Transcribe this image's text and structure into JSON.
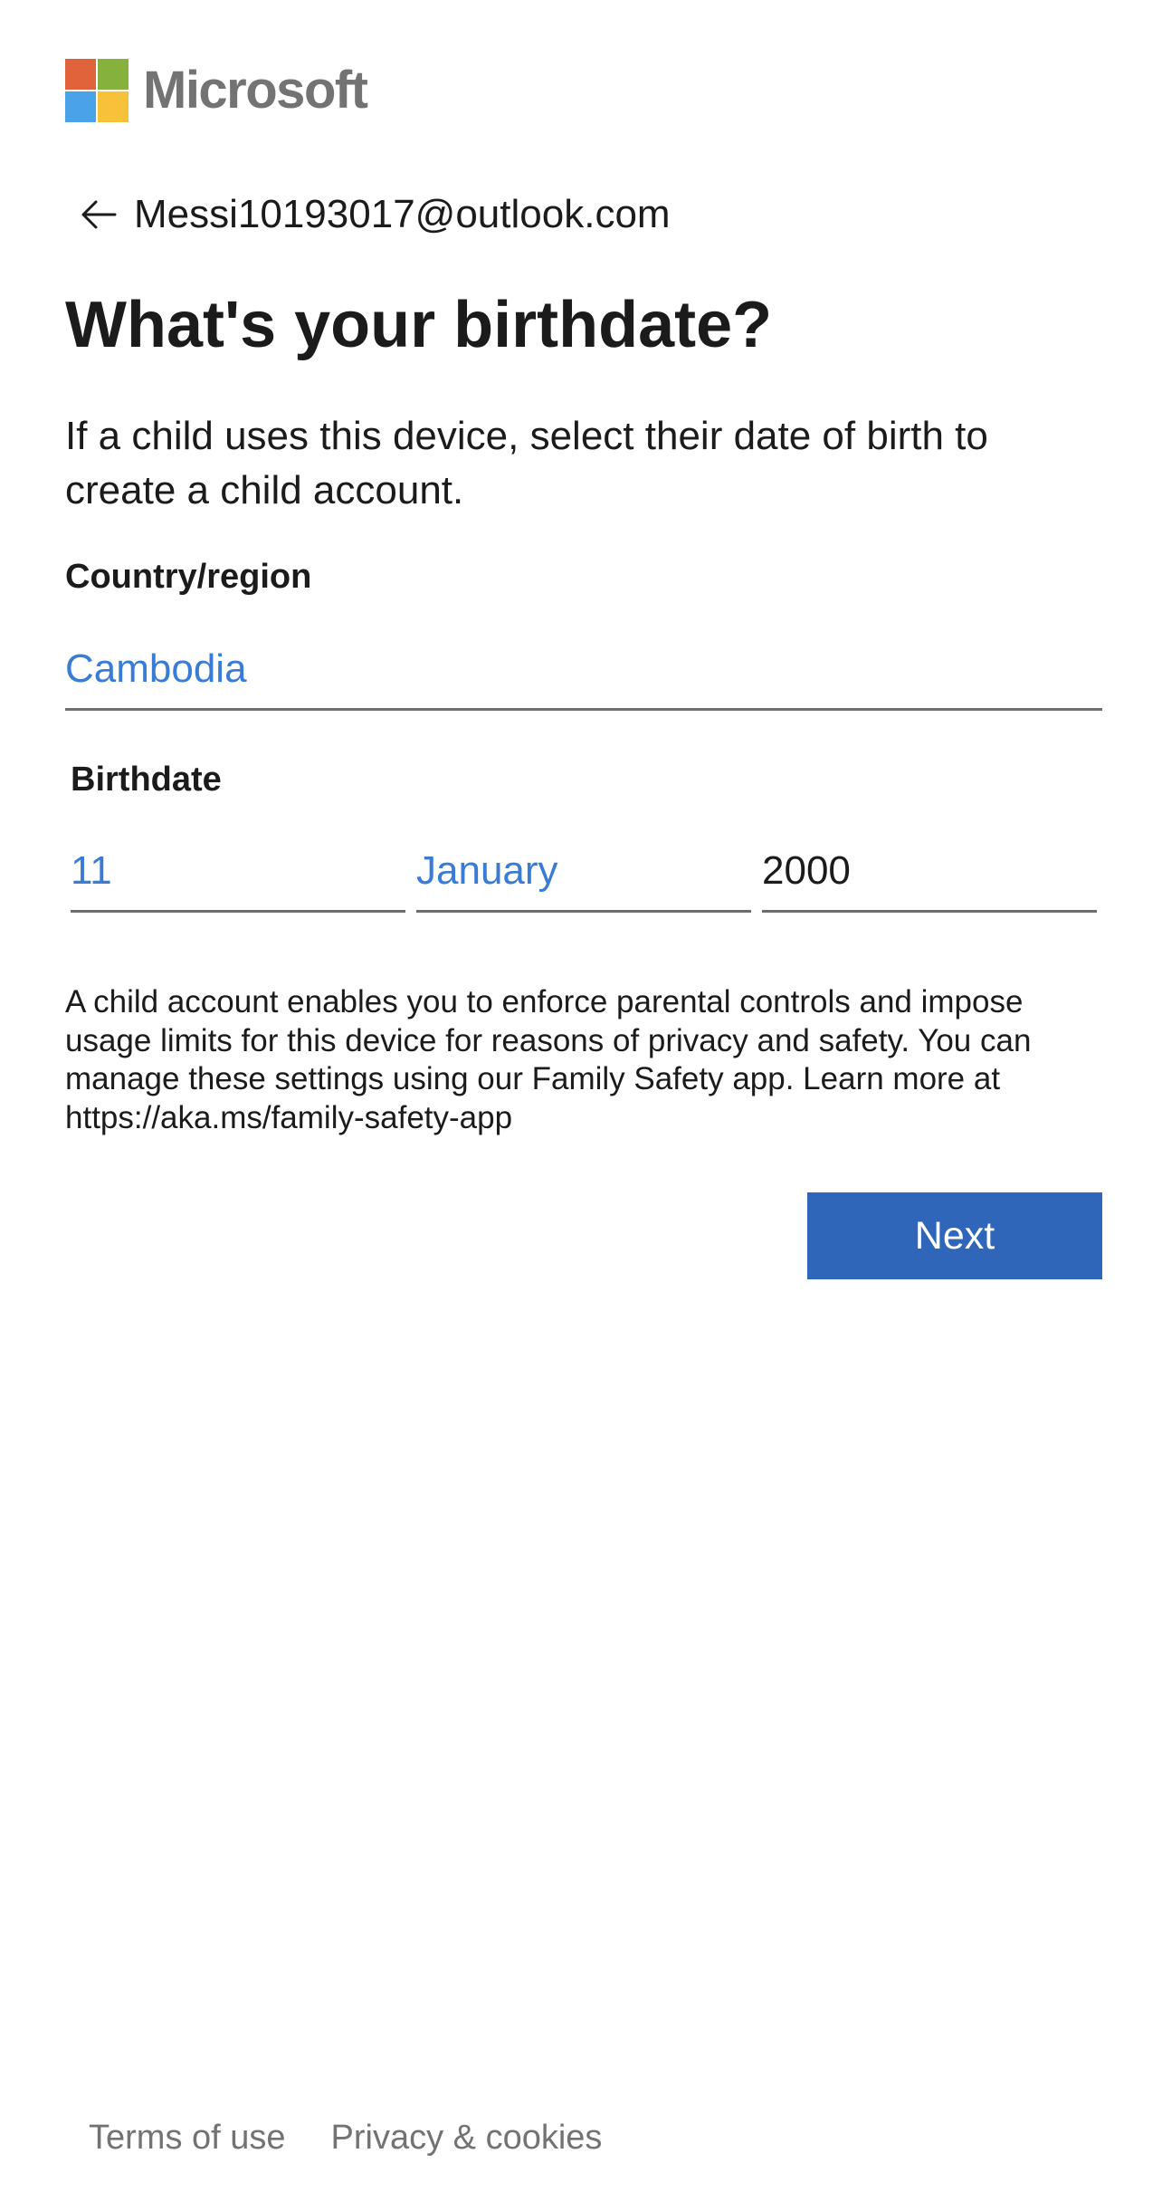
{
  "brand": {
    "name": "Microsoft",
    "logo_colors": [
      "#f25022",
      "#7fba00",
      "#00a4ef",
      "#ffb900"
    ],
    "logo_colors_rendered": [
      "#e1633c",
      "#86b13c",
      "#4aa3e8",
      "#f7c13a"
    ]
  },
  "identity": {
    "back_icon": "arrow-left-icon",
    "email": "Messi10193017@outlook.com"
  },
  "page": {
    "title": "What's your birthdate?",
    "description": "If a child uses this device, select their date of birth to create a child account."
  },
  "country": {
    "label": "Country/region",
    "value": "Cambodia"
  },
  "birthdate": {
    "label": "Birthdate",
    "day": "11",
    "month": "January",
    "year": "2000"
  },
  "info_text": "A child account enables you to enforce parental controls and impose usage limits for this device for reasons of privacy and safety. You can manage these settings using our Family Safety app. Learn more at https://aka.ms/family-safety-app",
  "actions": {
    "next_label": "Next"
  },
  "footer": {
    "terms": "Terms of use",
    "privacy": "Privacy & cookies"
  },
  "colors": {
    "accent": "#2f66b9",
    "link": "#3a7bd5",
    "muted": "#737373"
  }
}
